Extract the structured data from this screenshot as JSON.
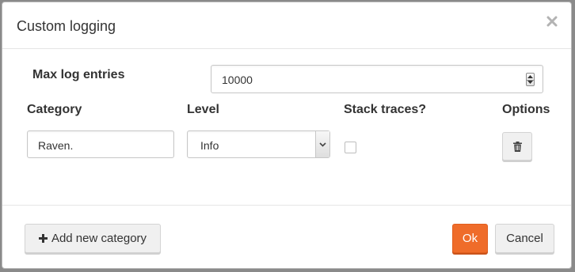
{
  "dialog": {
    "title": "Custom logging",
    "close_icon": "close-icon"
  },
  "max_entries": {
    "label": "Max log entries",
    "value": "10000"
  },
  "columns": {
    "category": "Category",
    "level": "Level",
    "stack_traces": "Stack traces?",
    "options": "Options"
  },
  "rows": [
    {
      "category": "Raven.",
      "level": "Info",
      "stack_traces": false,
      "delete_icon": "trash-icon"
    }
  ],
  "footer": {
    "add_label": "Add new category",
    "add_icon": "plus-icon",
    "ok_label": "Ok",
    "cancel_label": "Cancel"
  },
  "colors": {
    "primary": "#ef6c2a"
  }
}
